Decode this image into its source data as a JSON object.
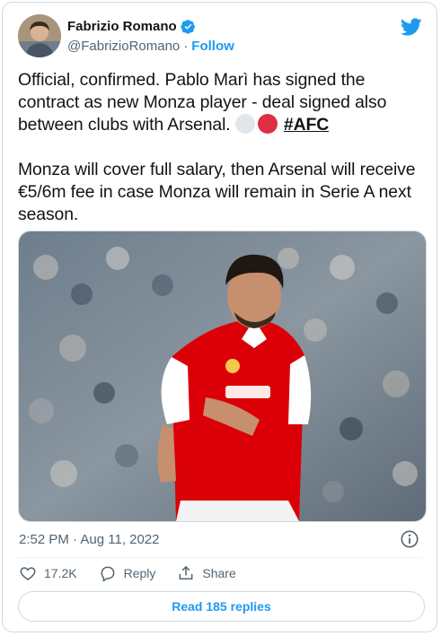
{
  "author": {
    "name": "Fabrizio Romano",
    "handle": "@FabrizioRomano",
    "separator": "·",
    "follow_label": "Follow"
  },
  "tweet": {
    "paragraph1": "Official, confirmed. Pablo Marì has signed the contract as new Monza player - deal signed also between clubs with Arsenal.",
    "hashtag": "#AFC",
    "paragraph2": "Monza will cover full salary, then Arsenal will receive €5/6m fee in case Monza will remain in Serie A next season.",
    "emoji": [
      "white-circle",
      "red-circle"
    ]
  },
  "meta": {
    "time": "2:52 PM",
    "date": "Aug 11, 2022",
    "dot": "·"
  },
  "actions": {
    "likes": "17.2K",
    "reply_label": "Reply",
    "share_label": "Share"
  },
  "read_replies_label": "Read 185 replies",
  "colors": {
    "accent": "#1d9bf0",
    "text": "#0f1419",
    "secondary": "#536471",
    "border": "#cfd9de",
    "arsenal_red": "#db0007"
  },
  "icons": [
    "verified-badge-icon",
    "twitter-bird-icon",
    "info-icon",
    "heart-icon",
    "reply-icon",
    "share-icon"
  ]
}
